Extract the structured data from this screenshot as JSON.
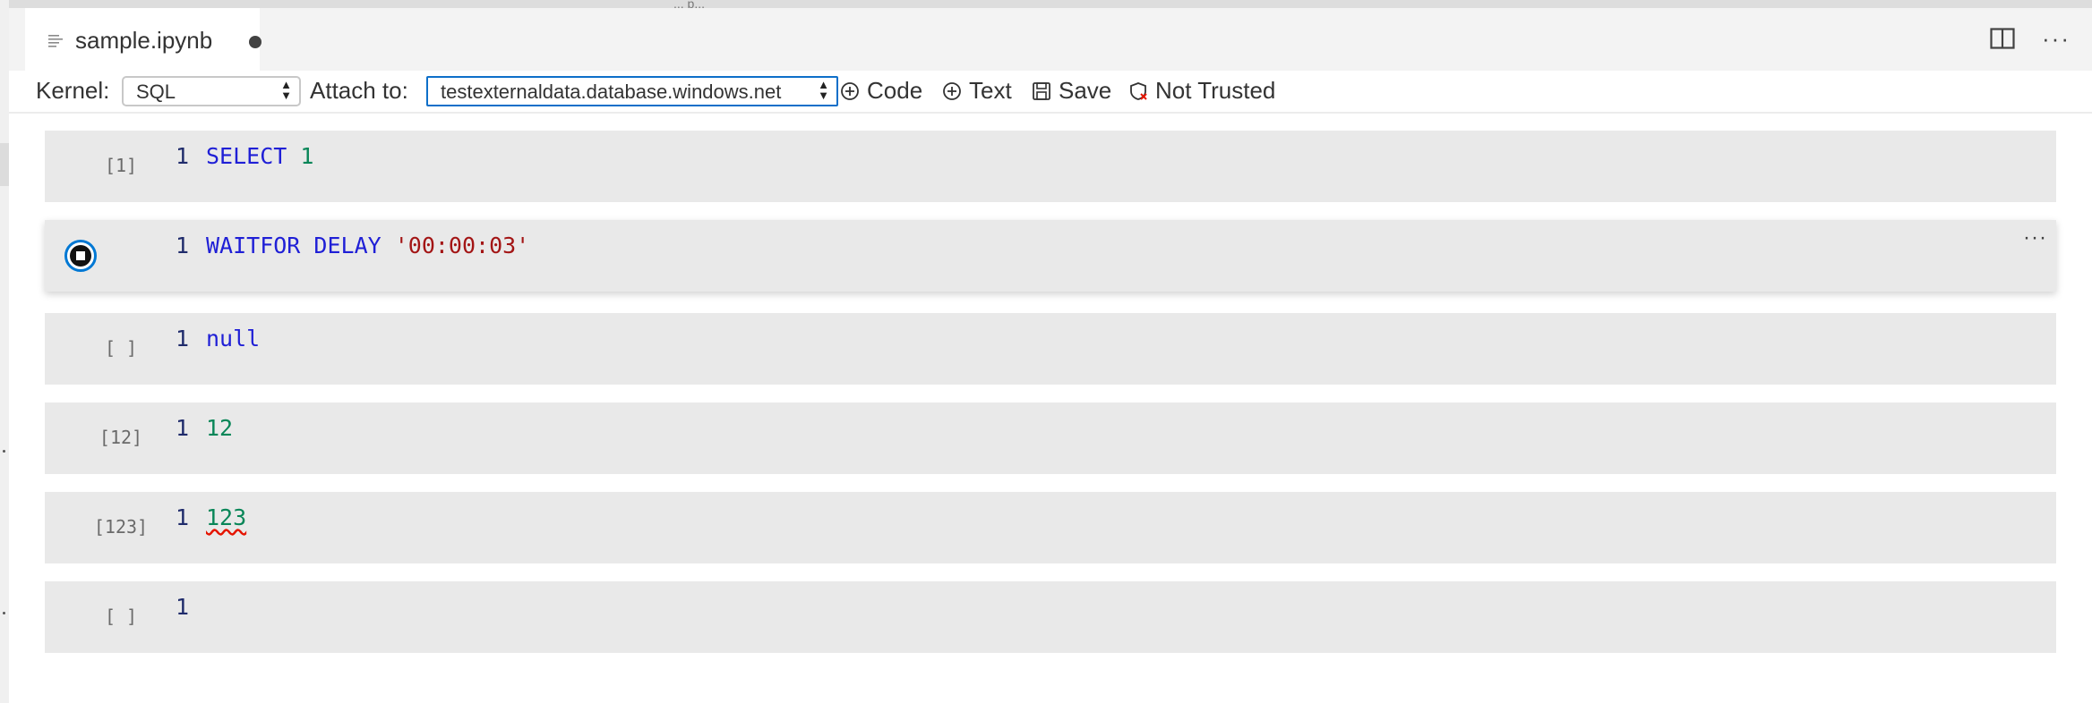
{
  "top_fragment": "... p...",
  "tab": {
    "title": "sample.ipynb"
  },
  "editor_actions": {
    "more": "···"
  },
  "toolbar": {
    "kernel_label": "Kernel:",
    "kernel_value": "SQL",
    "attach_label": "Attach to:",
    "attach_value": "testexternaldata.database.windows.net",
    "code_label": "Code",
    "text_label": "Text",
    "save_label": "Save",
    "trust_label": "Not Trusted"
  },
  "cells": [
    {
      "exec": "[1]",
      "line": "1",
      "tokens": [
        {
          "t": "SELECT ",
          "k": "kw"
        },
        {
          "t": "1",
          "k": "num"
        }
      ]
    },
    {
      "exec": "",
      "line": "1",
      "running": true,
      "tokens": [
        {
          "t": "WAITFOR DELAY ",
          "k": "kw"
        },
        {
          "t": "'00:00:03'",
          "k": "str"
        }
      ]
    },
    {
      "exec": "[ ]",
      "line": "1",
      "tokens": [
        {
          "t": "null",
          "k": "kw"
        }
      ]
    },
    {
      "exec": "[12]",
      "line": "1",
      "tokens": [
        {
          "t": "12",
          "k": "num"
        }
      ]
    },
    {
      "exec": "[123]",
      "line": "1",
      "tokens": [
        {
          "t": "123",
          "k": "num squiggle"
        }
      ]
    },
    {
      "exec": "[ ]",
      "line": "1",
      "tokens": []
    }
  ],
  "colors": {
    "accent": "#0078d4",
    "keyword": "#1f1fd6",
    "number": "#098658",
    "string": "#a31515",
    "cell_bg": "#e9e9e9"
  }
}
